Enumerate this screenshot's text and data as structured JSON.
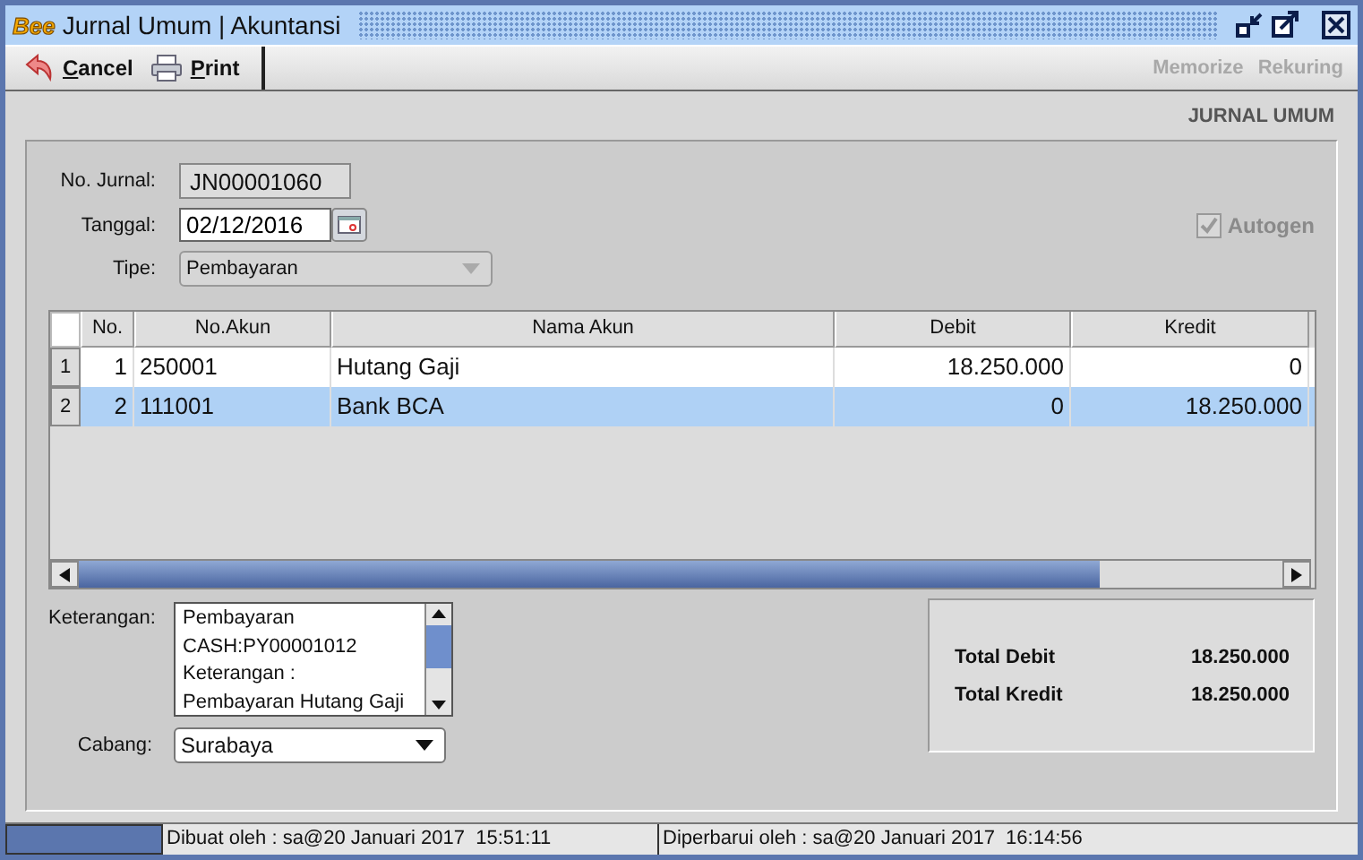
{
  "window": {
    "logo": "Bee",
    "title": "Jurnal Umum | Akuntansi"
  },
  "toolbar": {
    "buttons": [
      {
        "label": "Cancel",
        "kind": "cancel"
      },
      {
        "label": "Print",
        "kind": "print"
      }
    ],
    "right_actions": [
      {
        "label": "Memorize",
        "disabled": true
      },
      {
        "label": "Rekuring",
        "disabled": true
      }
    ]
  },
  "heading": "JURNAL UMUM",
  "form": {
    "no_jurnal": {
      "label": "No. Jurnal:",
      "value": "JN00001060"
    },
    "tanggal": {
      "label": "Tanggal:",
      "value": "02/12/2016"
    },
    "tipe": {
      "label": "Tipe:",
      "value": "Pembayaran",
      "disabled": true
    },
    "autogen": {
      "label": "Autogen",
      "checked": true,
      "disabled": true
    }
  },
  "table": {
    "columns": [
      "No.",
      "No.Akun",
      "Nama Akun",
      "Debit",
      "Kredit"
    ],
    "rows": [
      {
        "row_header": "1",
        "cells": [
          "1",
          "250001",
          "Hutang Gaji",
          "18.250.000",
          "0"
        ],
        "selected": false
      },
      {
        "row_header": "2",
        "cells": [
          "2",
          "111001",
          "Bank BCA",
          "0",
          "18.250.000"
        ],
        "selected": true
      }
    ]
  },
  "keterangan": {
    "label": "Keterangan:",
    "lines": [
      "Pembayaran",
      "CASH:PY00001012",
      "Keterangan :",
      "Pembayaran Hutang Gaji"
    ]
  },
  "cabang": {
    "label": "Cabang:",
    "value": "Surabaya"
  },
  "totals": [
    {
      "label": "Total Debit",
      "value": "18.250.000"
    },
    {
      "label": "Total Kredit",
      "value": "18.250.000"
    }
  ],
  "status_bar": [
    "Dibuat oleh : sa@20 Januari 2017  15:51:11",
    "Diperbarui oleh : sa@20 Januari 2017  16:14:56"
  ]
}
